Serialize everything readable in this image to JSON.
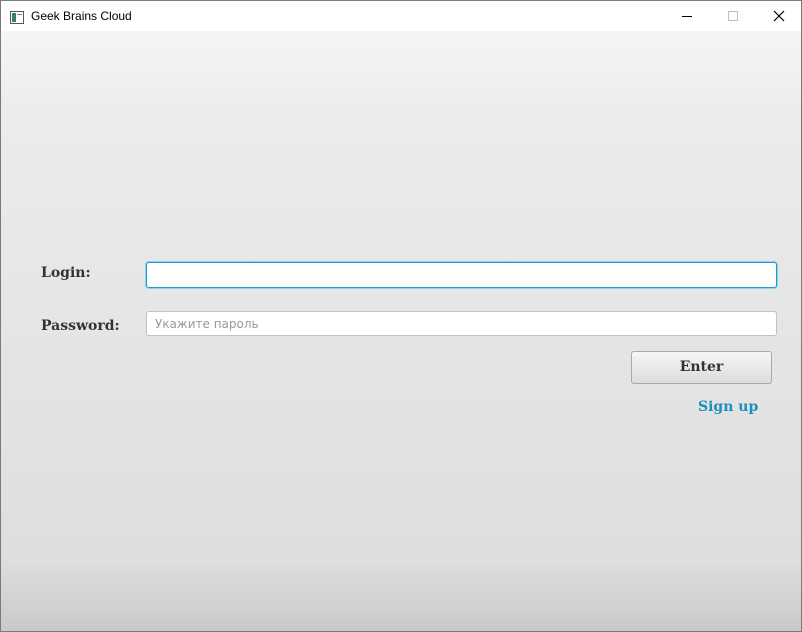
{
  "window": {
    "title": "Geek Brains Cloud"
  },
  "form": {
    "login_label": "Login:",
    "login_value": "",
    "password_label": "Password:",
    "password_placeholder": "Укажите пароль",
    "password_value": "",
    "enter_label": "Enter",
    "signup_label": "Sign up"
  },
  "colors": {
    "accent": "#1b8fbf",
    "focus_border": "#1c9bd1"
  },
  "icons": {
    "app": "app-window-icon",
    "minimize": "minimize-icon",
    "maximize": "maximize-icon",
    "close": "close-icon"
  }
}
